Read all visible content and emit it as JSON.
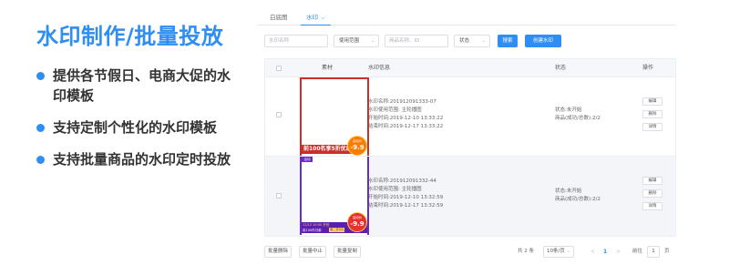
{
  "headline": "水印制作/批量投放",
  "features": [
    {
      "text": "提供各节假日、电商大促的水印模板"
    },
    {
      "text": "支持定制个性化的水印模板"
    },
    {
      "text": "支持批量商品的水印定时投放"
    }
  ],
  "tabs": [
    {
      "label": "白底图"
    },
    {
      "label": "水印"
    }
  ],
  "filters": {
    "name_placeholder": "水印名称",
    "scope_label": "使用范围",
    "product_placeholder": "商品名称、ID",
    "status_label": "状态",
    "search_label": "搜索",
    "create_label": "创建水印"
  },
  "table": {
    "headers": {
      "material": "素材",
      "info": "水印信息",
      "status": "状态",
      "action": "操作"
    },
    "rows": [
      {
        "name": "水印名称:201912091333-07",
        "scope": "水印使用范围: 主轮播图",
        "start": "开始时间:2019-12-10 13:33:22",
        "end": "结束时间:2019-12-17 13:33:22",
        "status": "状态:未开始",
        "products": "商品(成功/总数):2/2",
        "wm_bar": "前100名享5折优惠",
        "wm_circle_small": "活动价",
        "wm_circle_big": "-9.9"
      },
      {
        "name": "水印名称:201912091332-44",
        "scope": "水印使用范围: 主轮播图",
        "start": "开始时间:2019-12-10 13:32:59",
        "end": "结束时间:2019-12-17 13:32:59",
        "status": "状态:未开始",
        "products": "商品(成功/总数):2/2",
        "wm_tag": "活动",
        "wm_line1": "12/12 10:00 开抢",
        "wm_line2": "前100件付款",
        "wm_label": "第二件0元",
        "wm_circle_small": "活动价",
        "wm_circle_big": "-9.9"
      }
    ],
    "ops": {
      "edit": "编辑",
      "delete": "删除",
      "detail": "详情"
    }
  },
  "footer": {
    "batch_delete": "批量删除",
    "batch_stop": "批量中止",
    "batch_copy": "批量复制",
    "total": "共 2 条",
    "page_size": "10条/页",
    "prev": "<",
    "page": "1",
    "next": ">",
    "goto_label": "前往",
    "goto_value": "1",
    "page_unit": "页"
  },
  "colors": {
    "accent": "#2f8ef4",
    "wm_red": "#c9302c",
    "wm_purple": "#6a2bc4",
    "wm_orange": "#ff7a00"
  },
  "icons": [
    "chevron-down-icon",
    "caret-down-icon",
    "checkbox-icon",
    "chevron-left-icon",
    "chevron-right-icon"
  ]
}
